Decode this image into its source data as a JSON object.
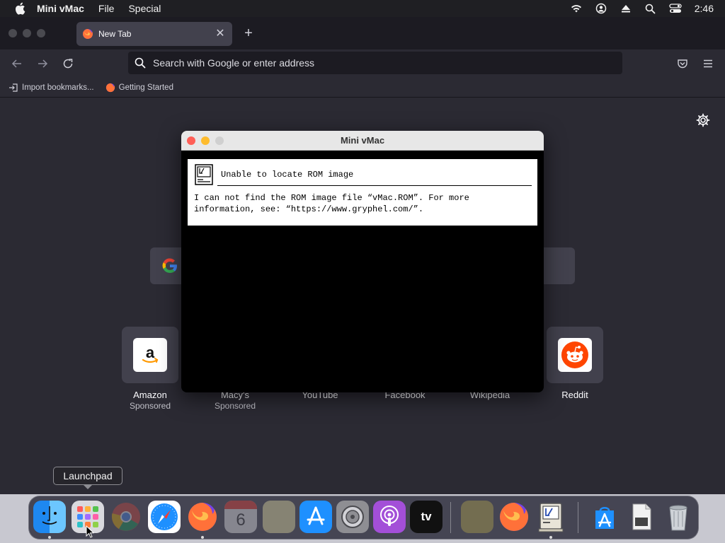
{
  "menubar": {
    "apple_icon": "apple-logo-icon",
    "app_name": "Mini vMac",
    "items": [
      "File",
      "Special"
    ],
    "status_icons": [
      "wifi-icon",
      "user-icon",
      "eject-icon",
      "spotlight-search-icon",
      "control-center-icon"
    ],
    "clock": "2:46"
  },
  "browser": {
    "tab": {
      "title": "New Tab",
      "favicon": "firefox-icon",
      "close_icon": "close-icon"
    },
    "new_tab_icon": "plus-icon",
    "nav": {
      "back_icon": "back-arrow-icon",
      "forward_icon": "forward-arrow-icon",
      "reload_icon": "reload-icon"
    },
    "urlbar": {
      "placeholder": "Search with Google or enter address"
    },
    "right_icons": [
      "pocket-icon",
      "hamburger-menu-icon"
    ],
    "bookmarks": [
      {
        "label": "Import bookmarks...",
        "icon": "import-icon"
      },
      {
        "label": "Getting Started",
        "icon": "firefox-icon"
      }
    ],
    "new_tab_page": {
      "settings_icon": "gear-icon",
      "search_logo": "google-logo-icon",
      "top_sites": [
        {
          "label": "Amazon",
          "sponsor": "Sponsored",
          "icon": "amazon-icon"
        },
        {
          "label": "Macy's",
          "sponsor": "Sponsored",
          "icon": "macys-icon"
        },
        {
          "label": "YouTube",
          "sponsor": "",
          "icon": "youtube-icon"
        },
        {
          "label": "Facebook",
          "sponsor": "",
          "icon": "facebook-icon"
        },
        {
          "label": "Wikipedia",
          "sponsor": "",
          "icon": "wikipedia-icon"
        },
        {
          "label": "Reddit",
          "sponsor": "",
          "icon": "reddit-icon"
        }
      ]
    }
  },
  "vmac_window": {
    "title": "Mini vMac",
    "alert": {
      "icon": "classic-mac-icon",
      "title": "Unable to locate ROM image",
      "message": "I can not find the ROM image file “vMac.ROM”. For more information, see: “https://www.gryphel.com/”."
    }
  },
  "tooltip": {
    "text": "Launchpad"
  },
  "dock": {
    "items": [
      {
        "name": "finder-icon",
        "running": true
      },
      {
        "name": "launchpad-icon",
        "running": false
      },
      {
        "name": "chrome-icon",
        "running": false
      },
      {
        "name": "safari-icon",
        "running": false
      },
      {
        "name": "firefox-icon",
        "running": true
      },
      {
        "name": "calendar-icon",
        "running": false
      },
      {
        "name": "notes-icon",
        "running": false
      },
      {
        "name": "app-store-icon",
        "running": false
      },
      {
        "name": "system-preferences-icon",
        "running": false
      },
      {
        "name": "podcasts-icon",
        "running": false
      },
      {
        "name": "apple-tv-icon",
        "running": false
      },
      {
        "name": "folder-icon",
        "running": false
      },
      {
        "name": "firefox-icon",
        "running": false
      },
      {
        "name": "mini-vmac-icon",
        "running": true
      },
      {
        "name": "app-store-downloads-icon",
        "running": false
      },
      {
        "name": "document-icon",
        "running": false
      },
      {
        "name": "trash-icon",
        "running": false
      }
    ],
    "calendar_day": "6",
    "appletv_label": "tv"
  },
  "colors": {
    "browser_bg": "#2b2a33",
    "tab_active": "#42414d",
    "amazon_orange": "#ff9900",
    "reddit_orange": "#ff4500",
    "close_red": "#ff5f57",
    "minimize_yellow": "#febc2e"
  }
}
